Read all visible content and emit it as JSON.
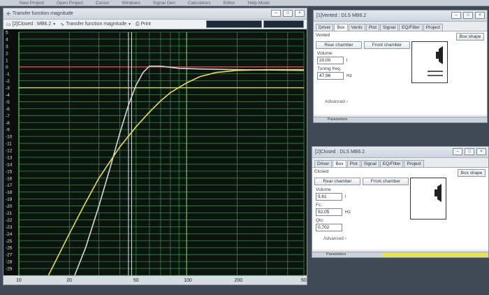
{
  "menu": [
    "New Project",
    "Open Project",
    "Cursor",
    "Windows",
    "Signal Gen",
    "Calculators",
    "Editor",
    "Help Mode"
  ],
  "graph_window": {
    "title": "Transfer function magnitude",
    "driver_select": "[2]Closed : MB6.2",
    "view_select": "Transfer function magnitude",
    "print_label": "Print"
  },
  "vented_window": {
    "title": "[1]Vented : DLS MB6.2",
    "tabs": [
      "Driver",
      "Box",
      "Vents",
      "Plot",
      "Signal",
      "EQ/Filter",
      "Project"
    ],
    "active_tab": "Box",
    "box_type": "Vented",
    "show_shape_btn": "Box shape",
    "rear_chamber_btn": "Rear chamber",
    "front_chamber_btn": "Front chamber",
    "volume_label": "Volume",
    "volume_value": "20,00",
    "volume_unit": "l",
    "tuning_label": "Tuning freq.",
    "tuning_value": "47,96",
    "tuning_unit": "Hz",
    "advanced": "Advanced",
    "status": "Parameters"
  },
  "closed_window": {
    "title": "[2]Closed : DLS MB6.2",
    "tabs": [
      "Driver",
      "Box",
      "Plot",
      "Signal",
      "EQ/Filter",
      "Project"
    ],
    "active_tab": "Box",
    "box_type": "Closed",
    "show_shape_btn": "Box shape",
    "rear_chamber_btn": "Rear chamber",
    "front_chamber_btn": "Front chamber",
    "volume_label": "Volume",
    "volume_value": "9,61",
    "volume_unit": "l",
    "fc_label": "Fc:",
    "fc_value": "92,05",
    "fc_unit": "Hz",
    "qtc_label": "Qtc:",
    "qtc_value": "0,702",
    "advanced": "Advanced",
    "status": "Parameters"
  },
  "chart_data": {
    "type": "line",
    "xscale": "log",
    "xlim": [
      10,
      500
    ],
    "ylim": [
      -30,
      5
    ],
    "x_ticks": [
      10,
      20,
      50,
      100,
      200,
      500
    ],
    "y_ticks": [
      5,
      4,
      3,
      2,
      1,
      0,
      -1,
      -2,
      -3,
      -4,
      -5,
      -6,
      -7,
      -8,
      -9,
      -10,
      -11,
      -12,
      -13,
      -14,
      -15,
      -16,
      -17,
      -18,
      -19,
      -20,
      -21,
      -22,
      -23,
      -24,
      -25,
      -26,
      -27,
      -28,
      -29
    ],
    "series": [
      {
        "color": "#d8d8d8",
        "points": [
          [
            21.5,
            -30
          ],
          [
            25,
            -26
          ],
          [
            30,
            -20
          ],
          [
            35,
            -14.5
          ],
          [
            40,
            -9.5
          ],
          [
            45,
            -5.5
          ],
          [
            50,
            -2.6
          ],
          [
            55,
            -0.8
          ],
          [
            60,
            0.1
          ],
          [
            70,
            0.1
          ],
          [
            90,
            -0.2
          ],
          [
            120,
            -0.3
          ],
          [
            200,
            -0.4
          ],
          [
            500,
            -0.5
          ]
        ]
      },
      {
        "color": "#e6e04a",
        "points": [
          [
            15,
            -30
          ],
          [
            20,
            -24
          ],
          [
            25,
            -19.5
          ],
          [
            30,
            -16
          ],
          [
            40,
            -11.5
          ],
          [
            50,
            -8.6
          ],
          [
            60,
            -6.5
          ],
          [
            70,
            -4.9
          ],
          [
            80,
            -3.7
          ],
          [
            100,
            -2.3
          ],
          [
            120,
            -1.4
          ],
          [
            150,
            -0.8
          ],
          [
            200,
            -0.5
          ],
          [
            300,
            -0.4
          ],
          [
            500,
            -0.4
          ]
        ]
      }
    ],
    "reference_lines": [
      {
        "y": 0,
        "color": "#e0474a"
      },
      {
        "y": -3,
        "color": "#c6e85a"
      }
    ],
    "markers_x": [
      45,
      47
    ]
  }
}
